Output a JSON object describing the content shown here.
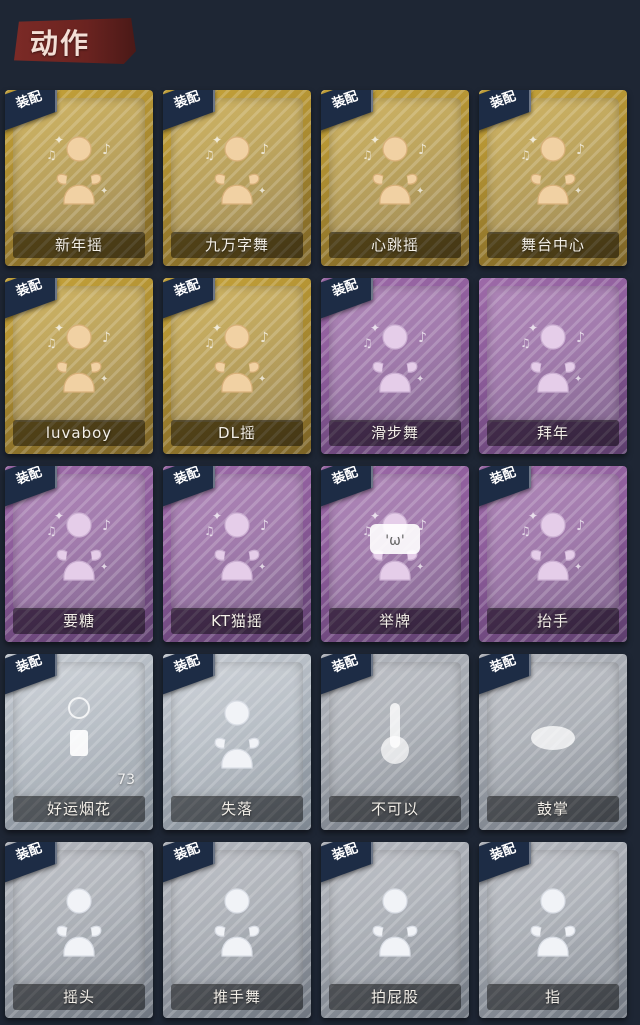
{
  "header": {
    "title": "动作"
  },
  "colors": {
    "background": "#1e2634",
    "title_banner": "#7b2a26",
    "badge": "#1d2c45",
    "gold": "#c7a43a",
    "purple": "#9d6aa8",
    "silver": "#aab2bb",
    "grey": "#9ea3ab"
  },
  "cards": [
    {
      "label": "新年摇",
      "tier": "gold",
      "badge": "装配",
      "icon": "new-year-dance-icon"
    },
    {
      "label": "九万字舞",
      "tier": "gold",
      "badge": "装配",
      "icon": "dance-icon"
    },
    {
      "label": "心跳摇",
      "tier": "gold",
      "badge": "装配",
      "icon": "heartbeat-dance-icon"
    },
    {
      "label": "舞台中心",
      "tier": "gold",
      "badge": "装配",
      "icon": "stage-center-icon"
    },
    {
      "label": "luvaboy",
      "tier": "gold",
      "badge": "装配",
      "icon": "dance-icon"
    },
    {
      "label": "DL摇",
      "tier": "gold",
      "badge": "装配",
      "icon": "dance-icon"
    },
    {
      "label": "滑步舞",
      "tier": "purple",
      "badge": "装配",
      "icon": "slide-dance-icon"
    },
    {
      "label": "拜年",
      "tier": "purple",
      "badge": "",
      "icon": "greeting-icon"
    },
    {
      "label": "要糖",
      "tier": "purple",
      "badge": "装配",
      "icon": "ask-candy-icon"
    },
    {
      "label": "KT猫摇",
      "tier": "purple",
      "badge": "装配",
      "icon": "cat-dance-icon"
    },
    {
      "label": "举牌",
      "tier": "purple",
      "badge": "装配",
      "icon": "sign-icon"
    },
    {
      "label": "抬手",
      "tier": "purple",
      "badge": "装配",
      "icon": "raise-hand-icon"
    },
    {
      "label": "好运烟花",
      "tier": "silver",
      "badge": "装配",
      "icon": "fireworks-icon",
      "count": "73"
    },
    {
      "label": "失落",
      "tier": "silver",
      "badge": "装配",
      "icon": "sad-icon"
    },
    {
      "label": "不可以",
      "tier": "grey",
      "badge": "装配",
      "icon": "no-icon"
    },
    {
      "label": "鼓掌",
      "tier": "grey",
      "badge": "装配",
      "icon": "clap-icon"
    },
    {
      "label": "摇头",
      "tier": "grey",
      "badge": "装配",
      "icon": "shake-head-icon"
    },
    {
      "label": "推手舞",
      "tier": "grey",
      "badge": "装配",
      "icon": "push-hand-dance-icon"
    },
    {
      "label": "拍屁股",
      "tier": "grey",
      "badge": "装配",
      "icon": "pat-butt-icon"
    },
    {
      "label": "指",
      "tier": "grey",
      "badge": "装配",
      "icon": "point-icon"
    }
  ]
}
